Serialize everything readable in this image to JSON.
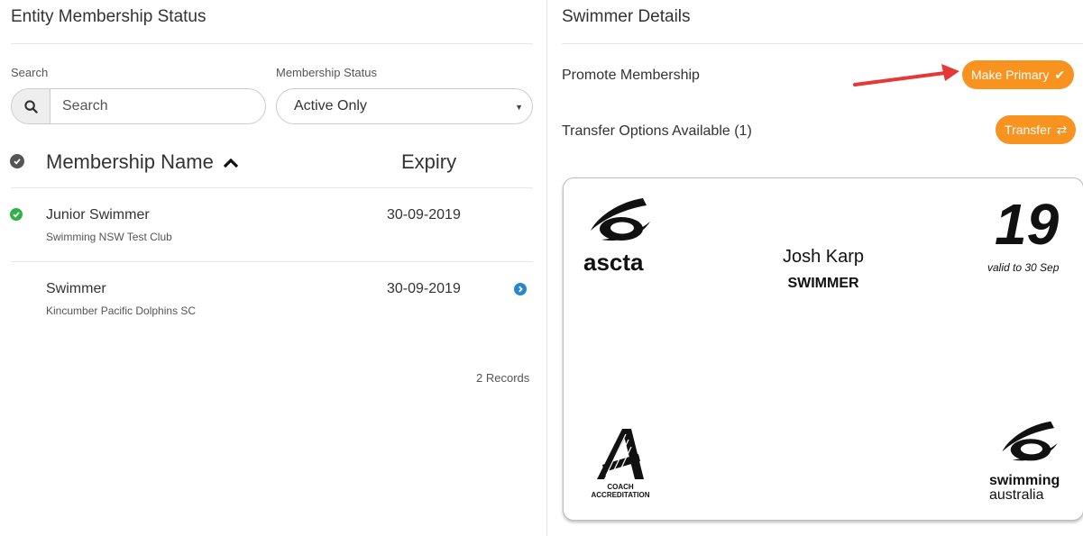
{
  "left": {
    "title": "Entity Membership Status",
    "search_label": "Search",
    "search_placeholder": "Search",
    "status_label": "Membership Status",
    "status_value": "Active Only",
    "columns": {
      "name": "Membership Name",
      "expiry": "Expiry"
    },
    "rows": [
      {
        "title": "Junior Swimmer",
        "sub": "Swimming NSW Test Club",
        "expiry": "30-09-2019"
      },
      {
        "title": "Swimmer",
        "sub": "Kincumber Pacific Dolphins SC",
        "expiry": "30-09-2019"
      }
    ],
    "records": "2 Records"
  },
  "right": {
    "title": "Swimmer Details",
    "promote_label": "Promote Membership",
    "make_primary": "Make Primary",
    "transfer_label": "Transfer Options Available (1)",
    "transfer_button": "Transfer"
  },
  "card": {
    "name": "Josh Karp",
    "role": "SWIMMER",
    "year": "19",
    "valid": "valid to 30 Sep",
    "logo_ascta": "ascta",
    "logo_sa_line1": "swimming",
    "logo_sa_line2": "australia",
    "coach_line1": "COACH",
    "coach_line2": "ACCREDITATION"
  },
  "colors": {
    "accent_orange": "#f7931e",
    "check_green": "#2fb344",
    "header_check_gray": "#555555",
    "chevron_blue": "#2a88c8",
    "arrow_red": "#e53935"
  },
  "icons": {
    "search": "search-icon",
    "caret": "caret-down-icon",
    "sort": "chevron-up-icon",
    "check": "check-circle-icon",
    "next": "chevron-right-circle-icon",
    "transfer": "swap-icon"
  }
}
